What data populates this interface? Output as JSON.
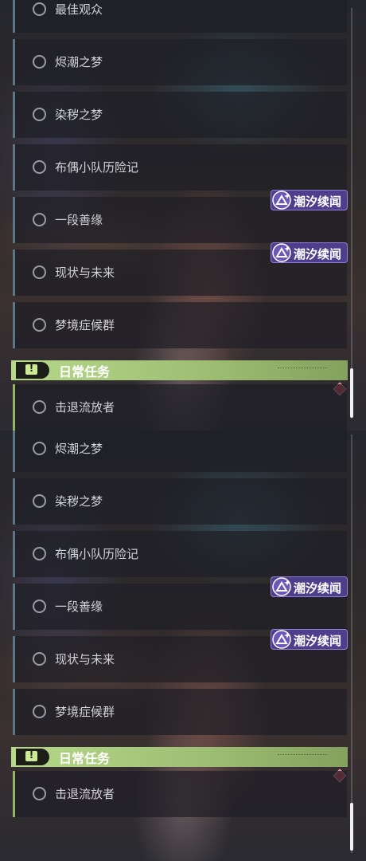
{
  "top_panel": {
    "quests": [
      {
        "label": "最佳观众"
      },
      {
        "label": "烬潮之梦"
      },
      {
        "label": "染秽之梦"
      },
      {
        "label": "布偶小队历险记"
      },
      {
        "label": "一段善缘",
        "badge": "潮汐续闻"
      },
      {
        "label": "现状与未来",
        "badge": "潮汐续闻"
      },
      {
        "label": "梦境症候群"
      }
    ],
    "daily_title": "日常任务",
    "daily_quests": [
      {
        "label": "击退流放者"
      }
    ]
  },
  "bottom_panel": {
    "quests": [
      {
        "label": "烬潮之梦"
      },
      {
        "label": "染秽之梦"
      },
      {
        "label": "布偶小队历险记"
      },
      {
        "label": "一段善缘",
        "badge": "潮汐续闻"
      },
      {
        "label": "现状与未来",
        "badge": "潮汐续闻"
      },
      {
        "label": "梦境症候群"
      }
    ],
    "daily_title": "日常任务",
    "daily_quests": [
      {
        "label": "击退流放者"
      }
    ]
  },
  "header_icon_glyph": "!",
  "colors": {
    "badge_bg": "#4e3f8c",
    "daily_header": "#b6d88a",
    "notify_diamond": "#d6475a",
    "quest_accent": "#5d7584"
  }
}
